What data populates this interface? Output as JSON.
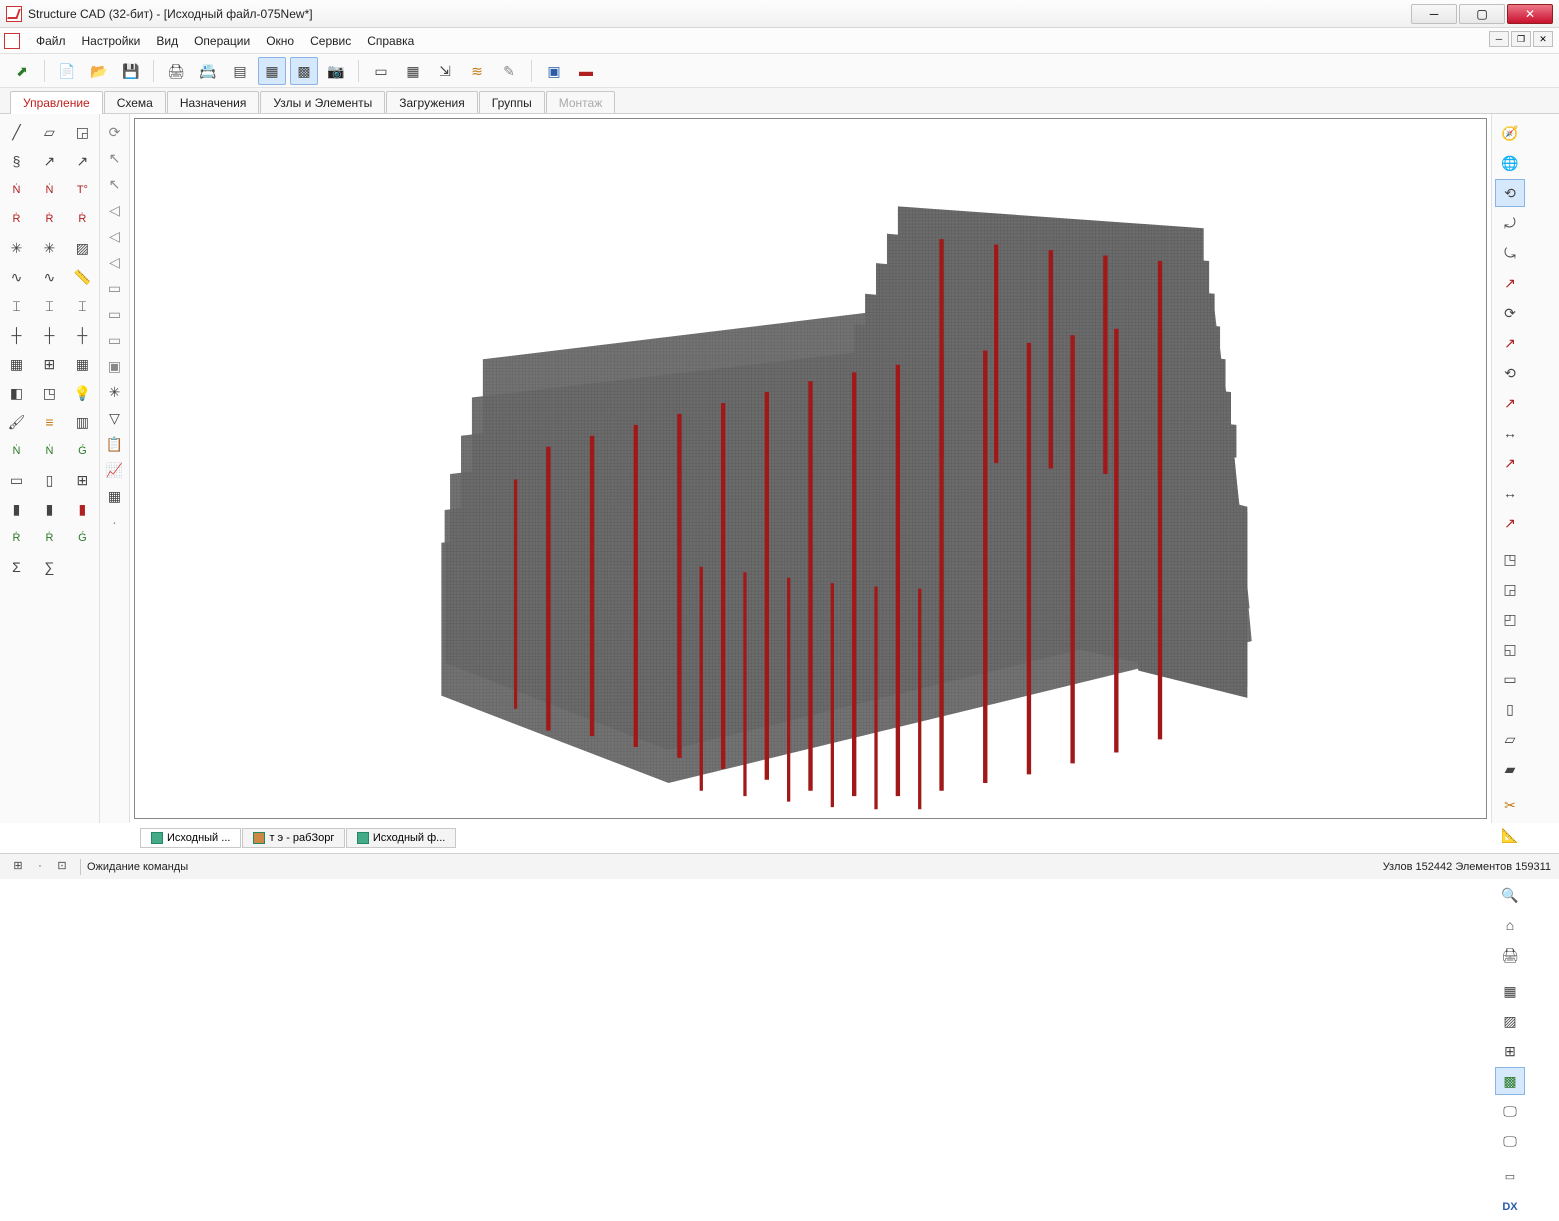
{
  "title": "Structure CAD (32-бит) - [Исходный файл-075New*]",
  "menubar": [
    "Файл",
    "Настройки",
    "Вид",
    "Операции",
    "Окно",
    "Сервис",
    "Справка"
  ],
  "tabs": {
    "items": [
      "Управление",
      "Схема",
      "Назначения",
      "Узлы и Элементы",
      "Загружения",
      "Группы",
      "Монтаж"
    ],
    "active_index": 0,
    "disabled_index": 6
  },
  "doc_tabs": {
    "items": [
      "Исходный ...",
      "т э - рабЗорг",
      "Исходный ф..."
    ],
    "active_index": 0
  },
  "statusbar": {
    "message": "Ожидание команды",
    "nodes_label": "Узлов",
    "nodes_count": "152442",
    "elements_label": "Элементов",
    "elements_count": "159311"
  },
  "toolbar_icons": [
    "open",
    "new",
    "open-file",
    "save",
    "print",
    "print-setup",
    "layers",
    "grid",
    "mesh",
    "camera",
    "props",
    "table",
    "export",
    "highlight",
    "paste",
    "image",
    "delete"
  ],
  "dx_label": "DX"
}
